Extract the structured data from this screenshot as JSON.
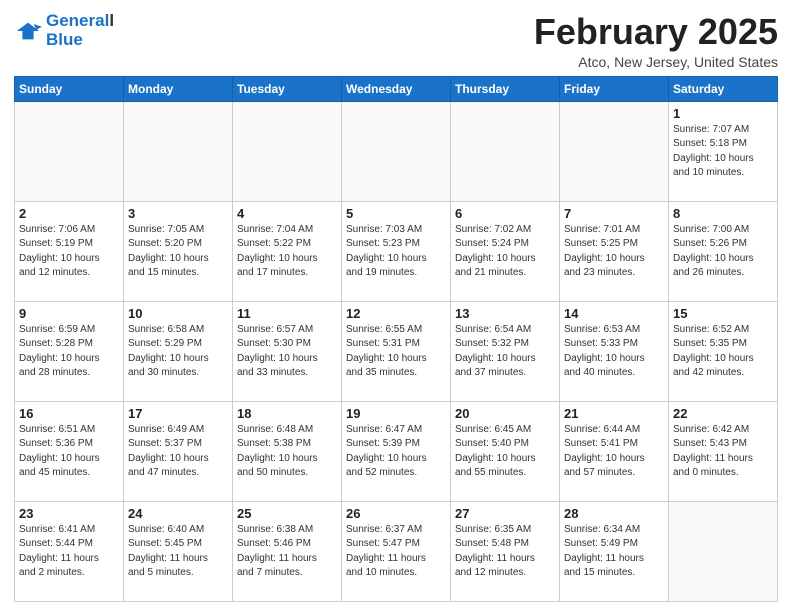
{
  "logo": {
    "line1": "General",
    "line2": "Blue"
  },
  "header": {
    "month": "February 2025",
    "location": "Atco, New Jersey, United States"
  },
  "weekdays": [
    "Sunday",
    "Monday",
    "Tuesday",
    "Wednesday",
    "Thursday",
    "Friday",
    "Saturday"
  ],
  "weeks": [
    [
      {
        "day": "",
        "info": ""
      },
      {
        "day": "",
        "info": ""
      },
      {
        "day": "",
        "info": ""
      },
      {
        "day": "",
        "info": ""
      },
      {
        "day": "",
        "info": ""
      },
      {
        "day": "",
        "info": ""
      },
      {
        "day": "1",
        "info": "Sunrise: 7:07 AM\nSunset: 5:18 PM\nDaylight: 10 hours\nand 10 minutes."
      }
    ],
    [
      {
        "day": "2",
        "info": "Sunrise: 7:06 AM\nSunset: 5:19 PM\nDaylight: 10 hours\nand 12 minutes."
      },
      {
        "day": "3",
        "info": "Sunrise: 7:05 AM\nSunset: 5:20 PM\nDaylight: 10 hours\nand 15 minutes."
      },
      {
        "day": "4",
        "info": "Sunrise: 7:04 AM\nSunset: 5:22 PM\nDaylight: 10 hours\nand 17 minutes."
      },
      {
        "day": "5",
        "info": "Sunrise: 7:03 AM\nSunset: 5:23 PM\nDaylight: 10 hours\nand 19 minutes."
      },
      {
        "day": "6",
        "info": "Sunrise: 7:02 AM\nSunset: 5:24 PM\nDaylight: 10 hours\nand 21 minutes."
      },
      {
        "day": "7",
        "info": "Sunrise: 7:01 AM\nSunset: 5:25 PM\nDaylight: 10 hours\nand 23 minutes."
      },
      {
        "day": "8",
        "info": "Sunrise: 7:00 AM\nSunset: 5:26 PM\nDaylight: 10 hours\nand 26 minutes."
      }
    ],
    [
      {
        "day": "9",
        "info": "Sunrise: 6:59 AM\nSunset: 5:28 PM\nDaylight: 10 hours\nand 28 minutes."
      },
      {
        "day": "10",
        "info": "Sunrise: 6:58 AM\nSunset: 5:29 PM\nDaylight: 10 hours\nand 30 minutes."
      },
      {
        "day": "11",
        "info": "Sunrise: 6:57 AM\nSunset: 5:30 PM\nDaylight: 10 hours\nand 33 minutes."
      },
      {
        "day": "12",
        "info": "Sunrise: 6:55 AM\nSunset: 5:31 PM\nDaylight: 10 hours\nand 35 minutes."
      },
      {
        "day": "13",
        "info": "Sunrise: 6:54 AM\nSunset: 5:32 PM\nDaylight: 10 hours\nand 37 minutes."
      },
      {
        "day": "14",
        "info": "Sunrise: 6:53 AM\nSunset: 5:33 PM\nDaylight: 10 hours\nand 40 minutes."
      },
      {
        "day": "15",
        "info": "Sunrise: 6:52 AM\nSunset: 5:35 PM\nDaylight: 10 hours\nand 42 minutes."
      }
    ],
    [
      {
        "day": "16",
        "info": "Sunrise: 6:51 AM\nSunset: 5:36 PM\nDaylight: 10 hours\nand 45 minutes."
      },
      {
        "day": "17",
        "info": "Sunrise: 6:49 AM\nSunset: 5:37 PM\nDaylight: 10 hours\nand 47 minutes."
      },
      {
        "day": "18",
        "info": "Sunrise: 6:48 AM\nSunset: 5:38 PM\nDaylight: 10 hours\nand 50 minutes."
      },
      {
        "day": "19",
        "info": "Sunrise: 6:47 AM\nSunset: 5:39 PM\nDaylight: 10 hours\nand 52 minutes."
      },
      {
        "day": "20",
        "info": "Sunrise: 6:45 AM\nSunset: 5:40 PM\nDaylight: 10 hours\nand 55 minutes."
      },
      {
        "day": "21",
        "info": "Sunrise: 6:44 AM\nSunset: 5:41 PM\nDaylight: 10 hours\nand 57 minutes."
      },
      {
        "day": "22",
        "info": "Sunrise: 6:42 AM\nSunset: 5:43 PM\nDaylight: 11 hours\nand 0 minutes."
      }
    ],
    [
      {
        "day": "23",
        "info": "Sunrise: 6:41 AM\nSunset: 5:44 PM\nDaylight: 11 hours\nand 2 minutes."
      },
      {
        "day": "24",
        "info": "Sunrise: 6:40 AM\nSunset: 5:45 PM\nDaylight: 11 hours\nand 5 minutes."
      },
      {
        "day": "25",
        "info": "Sunrise: 6:38 AM\nSunset: 5:46 PM\nDaylight: 11 hours\nand 7 minutes."
      },
      {
        "day": "26",
        "info": "Sunrise: 6:37 AM\nSunset: 5:47 PM\nDaylight: 11 hours\nand 10 minutes."
      },
      {
        "day": "27",
        "info": "Sunrise: 6:35 AM\nSunset: 5:48 PM\nDaylight: 11 hours\nand 12 minutes."
      },
      {
        "day": "28",
        "info": "Sunrise: 6:34 AM\nSunset: 5:49 PM\nDaylight: 11 hours\nand 15 minutes."
      },
      {
        "day": "",
        "info": ""
      }
    ]
  ]
}
